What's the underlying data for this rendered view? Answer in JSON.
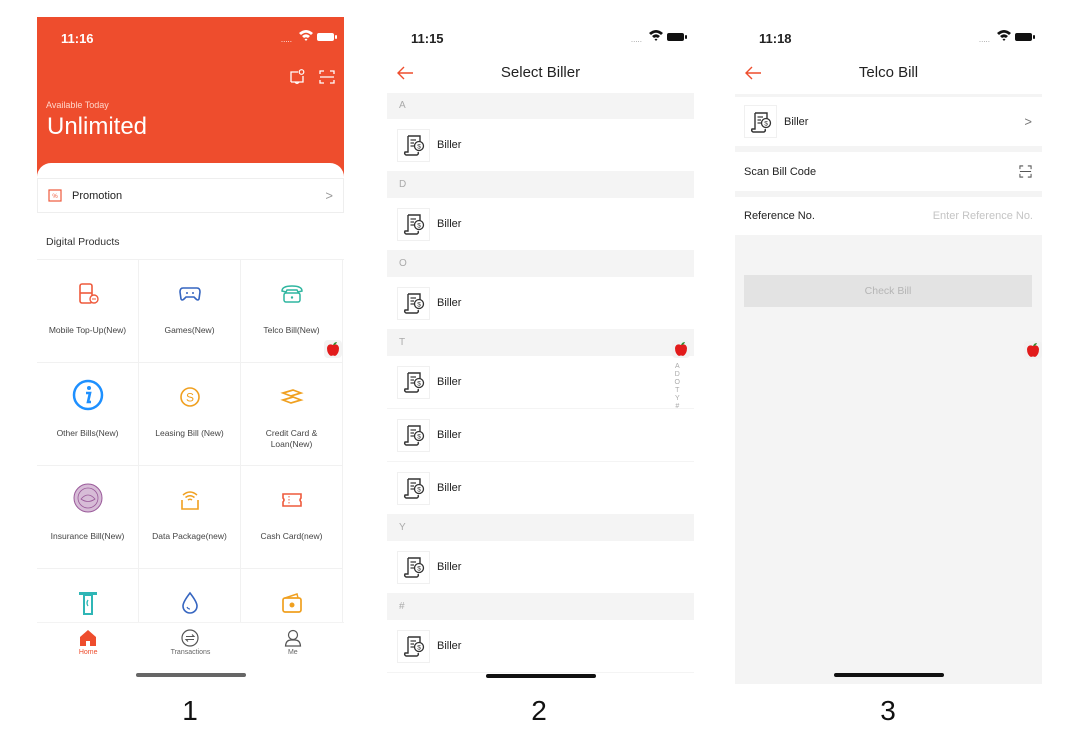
{
  "screens": [
    {
      "caption": "1",
      "status": {
        "time": "11:16",
        "signal": "....."
      },
      "header": {
        "available_label": "Available Today",
        "balance": "Unlimited",
        "icons": [
          "notification-bell-icon",
          "scan-icon"
        ]
      },
      "promotion": {
        "label": "Promotion",
        "icon": "promotion-ticket-icon",
        "chevron": ">"
      },
      "section_title": "Digital Products",
      "products": [
        {
          "label": "Mobile Top-Up(New)",
          "icon": "mobile-topup-icon",
          "color": "#ee5a3c"
        },
        {
          "label": "Games(New)",
          "icon": "gamepad-icon",
          "color": "#3565c0"
        },
        {
          "label": "Telco Bill(New)",
          "icon": "telephone-icon",
          "color": "#2fb6a0"
        },
        {
          "label": "Other Bills(New)",
          "icon": "info-icon",
          "color": "#1e90ff"
        },
        {
          "label": "Leasing Bill (New)",
          "icon": "dollar-coin-icon",
          "color": "#f0a020"
        },
        {
          "label": "Credit Card & Loan(New)",
          "icon": "hand-card-icon",
          "color": "#f0a020"
        },
        {
          "label": "Insurance Bill(New)",
          "icon": "insurance-seal-icon",
          "color": "#9a5a9a"
        },
        {
          "label": "Data Package(new)",
          "icon": "wifi-box-icon",
          "color": "#f0a020"
        },
        {
          "label": "Cash Card(new)",
          "icon": "ticket-icon",
          "color": "#ee5a3c"
        },
        {
          "label": "",
          "icon": "atm-icon",
          "color": "#2fb6b6"
        },
        {
          "label": "",
          "icon": "water-drop-icon",
          "color": "#3565c0"
        },
        {
          "label": "",
          "icon": "wallet-icon",
          "color": "#f0a020"
        }
      ],
      "tabbar": [
        {
          "label": "Home",
          "icon": "home-icon",
          "active": true
        },
        {
          "label": "Transactions",
          "icon": "transfer-icon",
          "active": false
        },
        {
          "label": "Me",
          "icon": "user-icon",
          "active": false
        }
      ]
    },
    {
      "caption": "2",
      "status": {
        "time": "11:15",
        "signal": "....."
      },
      "title": "Select Biller",
      "sections": [
        {
          "letter": "A",
          "billers": [
            "Biller"
          ]
        },
        {
          "letter": "D",
          "billers": [
            "Biller"
          ]
        },
        {
          "letter": "O",
          "billers": [
            "Biller"
          ]
        },
        {
          "letter": "T",
          "billers": [
            "Biller",
            "Biller",
            "Biller"
          ]
        },
        {
          "letter": "Y",
          "billers": [
            "Biller"
          ]
        },
        {
          "letter": "#",
          "billers": [
            "Biller"
          ]
        }
      ],
      "index": [
        "A",
        "D",
        "O",
        "T",
        "Y",
        "#"
      ]
    },
    {
      "caption": "3",
      "status": {
        "time": "11:18",
        "signal": "....."
      },
      "title": "Telco Bill",
      "biller": {
        "label": "Biller",
        "chevron": ">"
      },
      "scan": {
        "label": "Scan Bill Code",
        "icon": "scan-icon"
      },
      "reference": {
        "label": "Reference No.",
        "placeholder": "Enter Reference No.",
        "value": ""
      },
      "check_button": "Check Bill"
    }
  ],
  "colors": {
    "brand": "#ee4d2d",
    "section_bg": "#f4f4f4"
  }
}
